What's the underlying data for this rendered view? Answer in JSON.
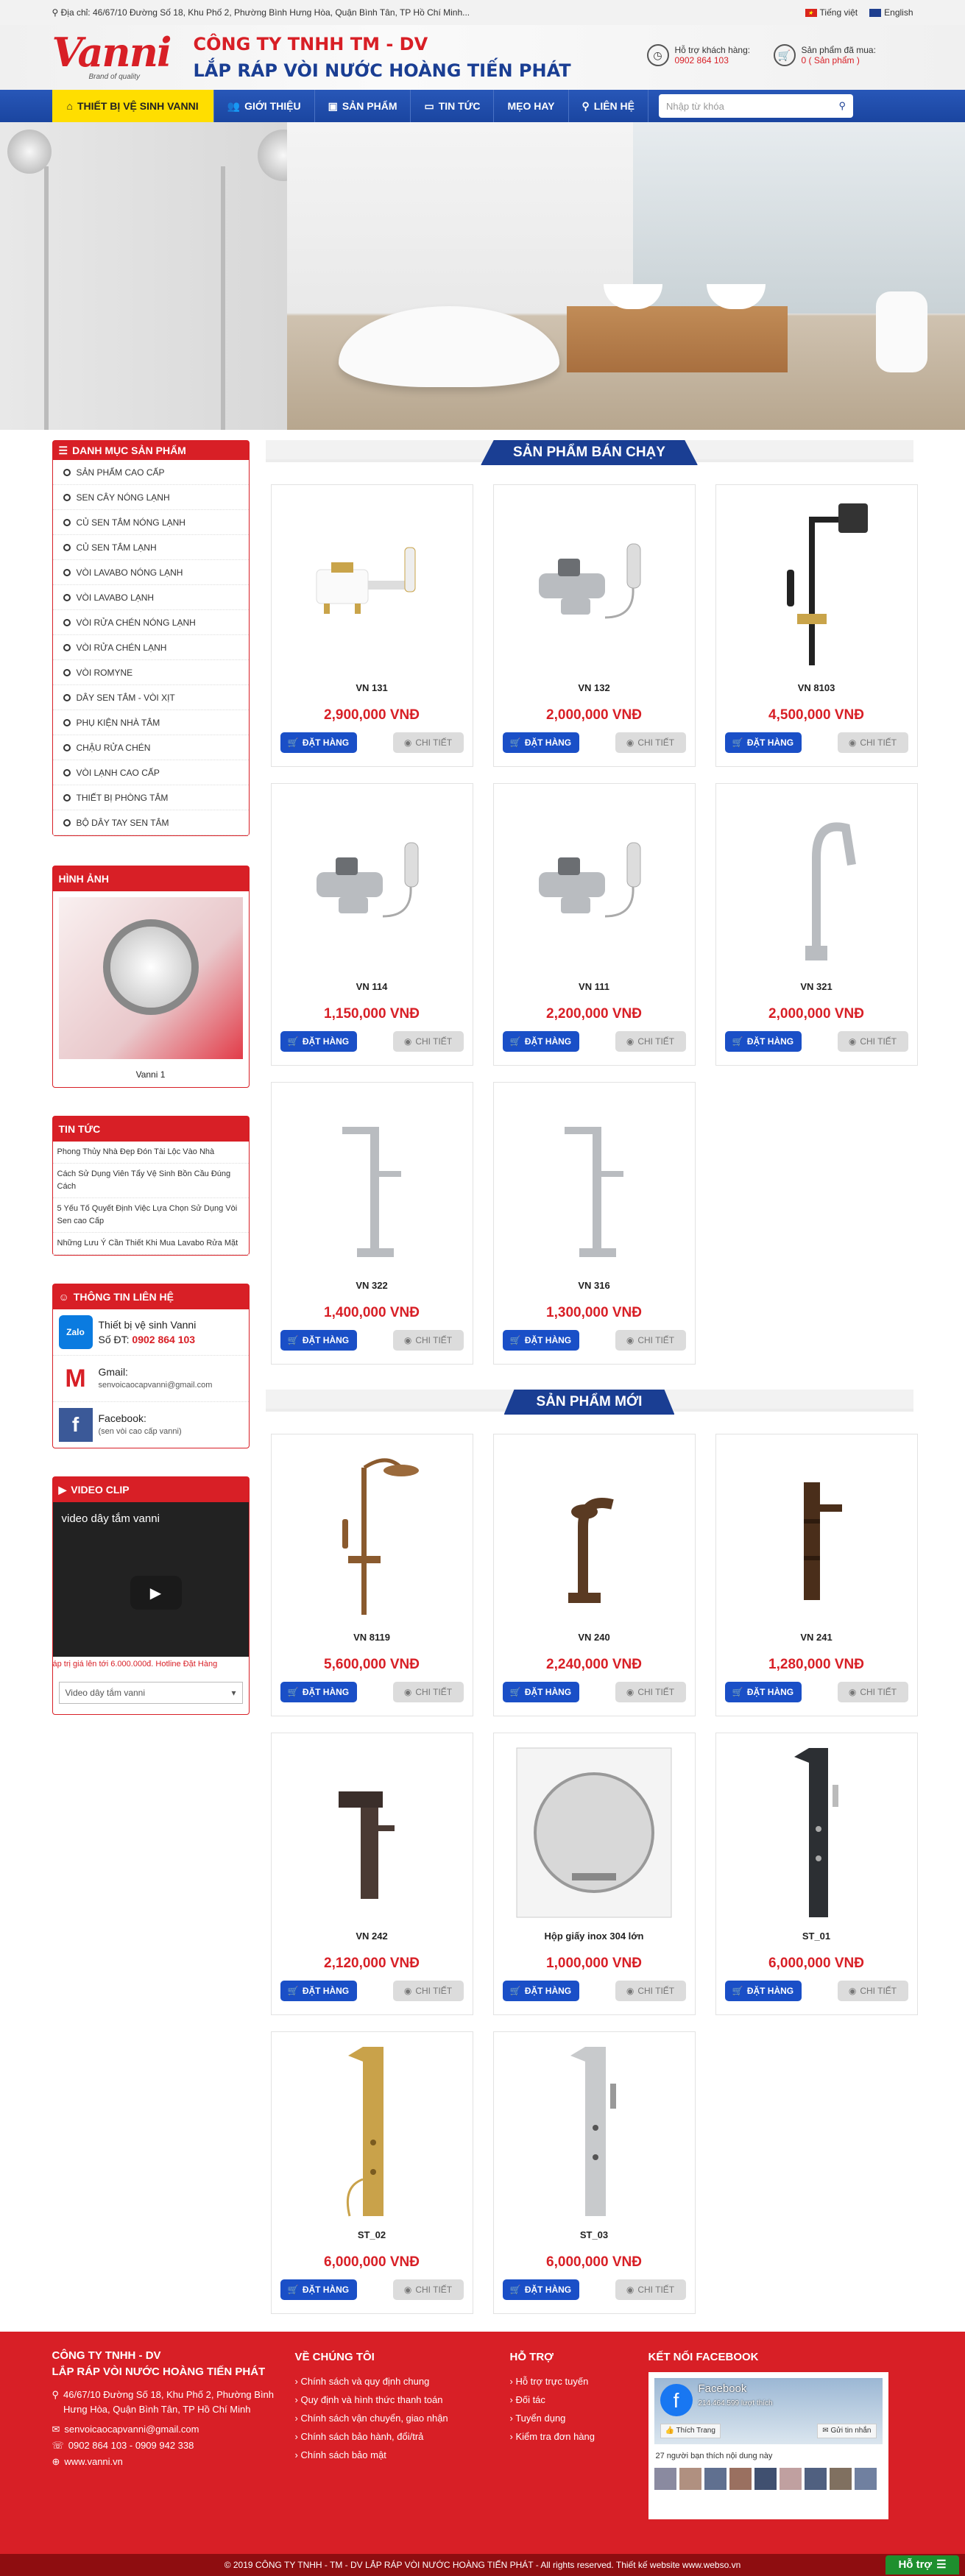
{
  "topbar": {
    "address": "Địa chỉ: 46/67/10 Đường Số 18, Khu Phố 2, Phường Bình Hưng Hòa, Quận Bình Tân, TP Hồ Chí Minh...",
    "lang_vi": "Tiếng việt",
    "lang_en": "English"
  },
  "header": {
    "logo": "Vanni",
    "logo_tagline": "Brand of quality",
    "company_line1": "CÔNG TY TNHH TM - DV",
    "company_line2": "LẮP RÁP VÒI NƯỚC HOÀNG TIẾN PHÁT",
    "support_label": "Hỗ trợ khách hàng:",
    "support_phone": "0902 864 103",
    "cart_label": "Sản phẩm đã mua:",
    "cart_count": "0 ( Sản phẩm )"
  },
  "nav": {
    "items": [
      "THIẾT BỊ VỆ SINH VANNI",
      "GIỚI THIỆU",
      "SẢN PHẨM",
      "TIN TỨC",
      "MẸO HAY",
      "LIÊN HỆ"
    ],
    "search_placeholder": "Nhập từ khóa"
  },
  "sidebar": {
    "categories_title": "DANH MỤC SẢN PHẨM",
    "categories": [
      "SẢN PHẨM CAO CẤP",
      "SEN CÂY NÓNG LẠNH",
      "CỦ SEN TẮM NÓNG LẠNH",
      "CỦ SEN TẮM LẠNH",
      "VÒI LAVABO NÓNG LẠNH",
      "VÒI LAVABO LẠNH",
      "VÒI RỬA CHÉN NÓNG LẠNH",
      "VÒI RỬA CHÉN LẠNH",
      "VÒI ROMYNE",
      "DÂY SEN TẮM - VÒI XỊT",
      "PHỤ KIỆN NHÀ TẮM",
      "CHẬU RỬA CHÉN",
      "VÒI LẠNH CAO CẤP",
      "THIẾT BỊ PHÒNG TẮM",
      "BỘ DÂY TAY SEN TẮM"
    ],
    "images_title": "HÌNH ẢNH",
    "image_caption": "Vanni 1",
    "news_title": "TIN TỨC",
    "news": [
      "Phong Thủy Nhà Đẹp Đón Tài Lộc Vào Nhà",
      "Cách Sử Dụng Viên Tẩy Vệ Sinh Bồn Cầu Đúng Cách",
      "5 Yếu Tố Quyết Định Việc Lựa Chọn Sử Dụng Vòi Sen cao Cấp",
      "Những Lưu Ý Cần Thiết Khi Mua Lavabo Rửa Mặt"
    ],
    "contact_title": "THÔNG TIN LIÊN HỆ",
    "contact": {
      "zalo_icon": "Zalo",
      "zalo_name": "Thiết bị vệ sinh Vanni",
      "zalo_phone_label": "Số ĐT:",
      "zalo_phone": "0902 864 103",
      "gmail_label": "Gmail:",
      "gmail": "senvoicaocapvanni@gmail.com",
      "facebook_label": "Facebook:",
      "facebook": "(sen vòi cao cấp vanni)"
    },
    "video_title": "VIDEO CLIP",
    "video_caption": "video dây tắm vanni",
    "video_strip": "áp trị giá lên tới 6.000.000đ. Hotline Đặt Hàng",
    "video_select": "Video dây tắm vanni"
  },
  "sections": [
    {
      "title": "SẢN PHẨM BÁN CHẠY",
      "products": [
        {
          "name": "VN 131",
          "price": "2,900,000 VNĐ",
          "type": "tub-faucet-white"
        },
        {
          "name": "VN 132",
          "price": "2,000,000 VNĐ",
          "type": "tub-faucet-chrome"
        },
        {
          "name": "VN 8103",
          "price": "4,500,000 VNĐ",
          "type": "shower-column-black"
        },
        {
          "name": "VN 114",
          "price": "1,150,000 VNĐ",
          "type": "tub-faucet-chrome"
        },
        {
          "name": "VN 111",
          "price": "2,200,000 VNĐ",
          "type": "tub-faucet-chrome"
        },
        {
          "name": "VN 321",
          "price": "2,000,000 VNĐ",
          "type": "kitchen-faucet"
        },
        {
          "name": "VN 322",
          "price": "1,400,000 VNĐ",
          "type": "tall-faucet"
        },
        {
          "name": "VN 316",
          "price": "1,300,000 VNĐ",
          "type": "tall-faucet"
        }
      ]
    },
    {
      "title": "SẢN PHẨM MỚI",
      "products": [
        {
          "name": "VN 8119",
          "price": "5,600,000 VNĐ",
          "type": "shower-column-bronze"
        },
        {
          "name": "VN 240",
          "price": "2,240,000 VNĐ",
          "type": "bronze-faucet"
        },
        {
          "name": "VN 241",
          "price": "1,280,000 VNĐ",
          "type": "bronze-faucet-tall"
        },
        {
          "name": "VN 242",
          "price": "2,120,000 VNĐ",
          "type": "waterfall-faucet"
        },
        {
          "name": "Hộp giấy inox 304 lớn",
          "price": "1,000,000 VNĐ",
          "type": "paper-box"
        },
        {
          "name": "ST_01",
          "price": "6,000,000 VNĐ",
          "type": "shower-panel-black"
        },
        {
          "name": "ST_02",
          "price": "6,000,000 VNĐ",
          "type": "shower-panel-gold"
        },
        {
          "name": "ST_03",
          "price": "6,000,000 VNĐ",
          "type": "shower-panel-silver"
        }
      ]
    }
  ],
  "buttons": {
    "buy": "ĐẶT HÀNG",
    "detail": "CHI TIẾT"
  },
  "footer": {
    "company1": "CÔNG TY TNHH - DV",
    "company2": "LẮP RÁP VÒI NƯỚC HOÀNG TIẾN PHÁT",
    "address": "46/67/10 Đường Số 18, Khu Phố 2, Phường Bình Hưng Hòa, Quận Bình Tân, TP Hồ Chí Minh",
    "email": "senvoicaocapvanni@gmail.com",
    "phones": "0902 864 103 - 0909 942 338",
    "web": "www.vanni.vn",
    "col2_title": "VỀ CHÚNG TÔI",
    "col2": [
      "Chính sách và quy định chung",
      "Quy định và hình thức thanh toán",
      "Chính sách vận chuyển, giao nhận",
      "Chính sách bảo hành, đổi/trả",
      "Chính sách bảo mật"
    ],
    "col3_title": "HỖ TRỢ",
    "col3": [
      "Hỗ trợ trực tuyến",
      "Đối tác",
      "Tuyển dụng",
      "Kiểm tra đơn hàng"
    ],
    "col4_title": "KẾT NỐI FACEBOOK",
    "fb_name": "Facebook",
    "fb_likes": "214.464.599 lượt thích",
    "fb_like_btn": "Thích Trang",
    "fb_msg_btn": "Gửi tin nhắn",
    "fb_friends": "27 người bạn thích nội dung này",
    "copyright": "© 2019 CÔNG TY TNHH - TM - DV LẮP RÁP VÒI NƯỚC HOÀNG TIẾN PHÁT - All rights reserved. Thiết kế website www.webso.vn",
    "support_btn": "Hỗ trợ"
  },
  "colors": {
    "red": "#d81f26",
    "blue": "#1a3e93",
    "yellow": "#ffde00"
  }
}
